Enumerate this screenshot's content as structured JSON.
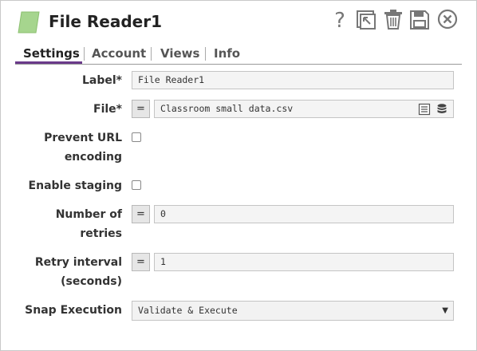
{
  "header": {
    "title": "File Reader1",
    "icons": [
      "help-icon",
      "export-icon",
      "trash-icon",
      "save-icon",
      "close-icon"
    ],
    "snap_color": "#a6d58e"
  },
  "tabs": [
    {
      "label": "Settings",
      "active": true
    },
    {
      "label": "Account",
      "active": false
    },
    {
      "label": "Views",
      "active": false
    },
    {
      "label": "Info",
      "active": false
    }
  ],
  "form": {
    "label": {
      "label": "Label*",
      "value": "File Reader1"
    },
    "file": {
      "label": "File*",
      "expr": "=",
      "value": "Classroom small data.csv"
    },
    "prevent_url": {
      "label_line1": "Prevent URL",
      "label_line2": "encoding",
      "checked": false
    },
    "enable_staging": {
      "label": "Enable staging",
      "checked": false
    },
    "retries": {
      "label_line1": "Number of",
      "label_line2": "retries",
      "expr": "=",
      "value": "0"
    },
    "retry_interval": {
      "label_line1": "Retry interval",
      "label_line2": "(seconds)",
      "expr": "=",
      "value": "1"
    },
    "snap_execution": {
      "label": "Snap Execution",
      "value": "Validate & Execute"
    }
  },
  "colors": {
    "accent": "#6a3a8a"
  }
}
